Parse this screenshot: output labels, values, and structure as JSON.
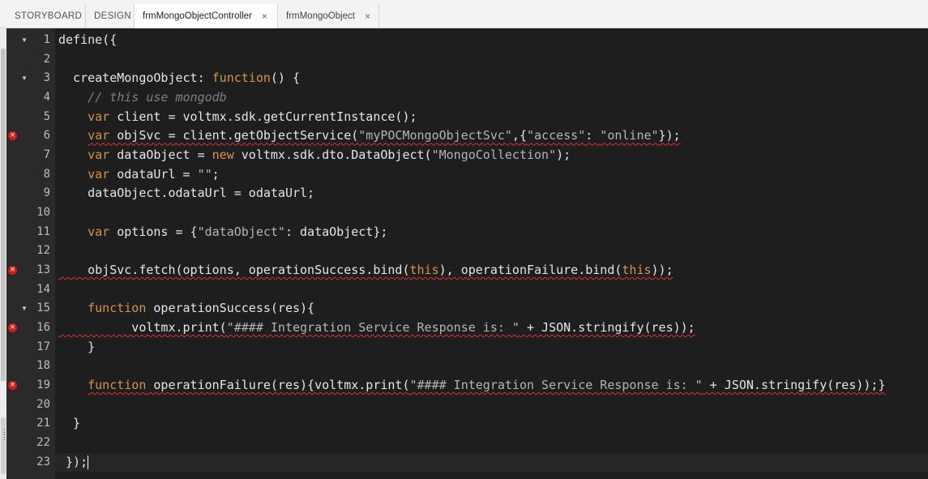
{
  "tabs": [
    {
      "label": "STORYBOARD",
      "closable": false,
      "active": false
    },
    {
      "label": "DESIGN",
      "closable": false,
      "active": false
    },
    {
      "label": "frmMongoObjectController",
      "closable": true,
      "active": true
    },
    {
      "label": "frmMongoObject",
      "closable": true,
      "active": false
    }
  ],
  "close_glyph": "×",
  "editor": {
    "colors": {
      "background": "#1e1e1e",
      "keyword": "#d4934f",
      "error": "#d11a1a"
    },
    "lines": [
      {
        "n": "1",
        "fold": true,
        "error": false
      },
      {
        "n": "2",
        "fold": false,
        "error": false
      },
      {
        "n": "3",
        "fold": true,
        "error": false
      },
      {
        "n": "4",
        "fold": false,
        "error": false
      },
      {
        "n": "5",
        "fold": false,
        "error": false
      },
      {
        "n": "6",
        "fold": false,
        "error": true
      },
      {
        "n": "7",
        "fold": false,
        "error": false
      },
      {
        "n": "8",
        "fold": false,
        "error": false
      },
      {
        "n": "9",
        "fold": false,
        "error": false
      },
      {
        "n": "10",
        "fold": false,
        "error": false
      },
      {
        "n": "11",
        "fold": false,
        "error": false
      },
      {
        "n": "12",
        "fold": false,
        "error": false
      },
      {
        "n": "13",
        "fold": false,
        "error": true
      },
      {
        "n": "14",
        "fold": false,
        "error": false
      },
      {
        "n": "15",
        "fold": true,
        "error": false
      },
      {
        "n": "16",
        "fold": false,
        "error": true
      },
      {
        "n": "17",
        "fold": false,
        "error": false
      },
      {
        "n": "18",
        "fold": false,
        "error": false
      },
      {
        "n": "19",
        "fold": false,
        "error": true
      },
      {
        "n": "20",
        "fold": false,
        "error": false
      },
      {
        "n": "21",
        "fold": false,
        "error": false
      },
      {
        "n": "22",
        "fold": false,
        "error": false
      },
      {
        "n": "23",
        "fold": false,
        "error": false
      }
    ],
    "code": {
      "l1": "define({",
      "l3a": "  createMongoObject: ",
      "l3b": "function",
      "l3c": "() {",
      "l4": "    // this use mongodb",
      "l5a": "    ",
      "l5b": "var",
      "l5c": " client = voltmx.sdk.getCurrentInstance();",
      "l6a": "    ",
      "l6b": "var",
      "l6c": " objSvc = client.getObjectService(",
      "l6d": "\"myPOCMongoObjectSvc\"",
      "l6e": ",{",
      "l6f": "\"access\"",
      "l6g": ": ",
      "l6h": "\"online\"",
      "l6i": "});",
      "l7a": "    ",
      "l7b": "var",
      "l7c": " dataObject = ",
      "l7d": "new",
      "l7e": " voltmx.sdk.dto.DataObject(",
      "l7f": "\"MongoCollection\"",
      "l7g": ");",
      "l8a": "    ",
      "l8b": "var",
      "l8c": " odataUrl = ",
      "l8d": "\"\"",
      "l8e": ";",
      "l9": "    dataObject.odataUrl = odataUrl;",
      "l11a": "    ",
      "l11b": "var",
      "l11c": " options = {",
      "l11d": "\"dataObject\"",
      "l11e": ": dataObject};",
      "l13a": "    objSvc.fetch(options, operationSuccess.bind(",
      "l13b": "this",
      "l13c": "), operationFailure.bind(",
      "l13d": "this",
      "l13e": "));",
      "l15a": "    ",
      "l15b": "function",
      "l15c": " operationSuccess(res){",
      "l16a": "          voltmx.print(",
      "l16b": "\"#### Integration Service Response is: \"",
      "l16c": " + JSON.stringify(res));",
      "l17": "    }",
      "l19a": "    ",
      "l19b": "function",
      "l19c": " operationFailure(res){voltmx.print(",
      "l19d": "\"#### Integration Service Response is: \"",
      "l19e": " + JSON.stringify(res));}",
      "l21": "  }",
      "l23": " });"
    }
  }
}
